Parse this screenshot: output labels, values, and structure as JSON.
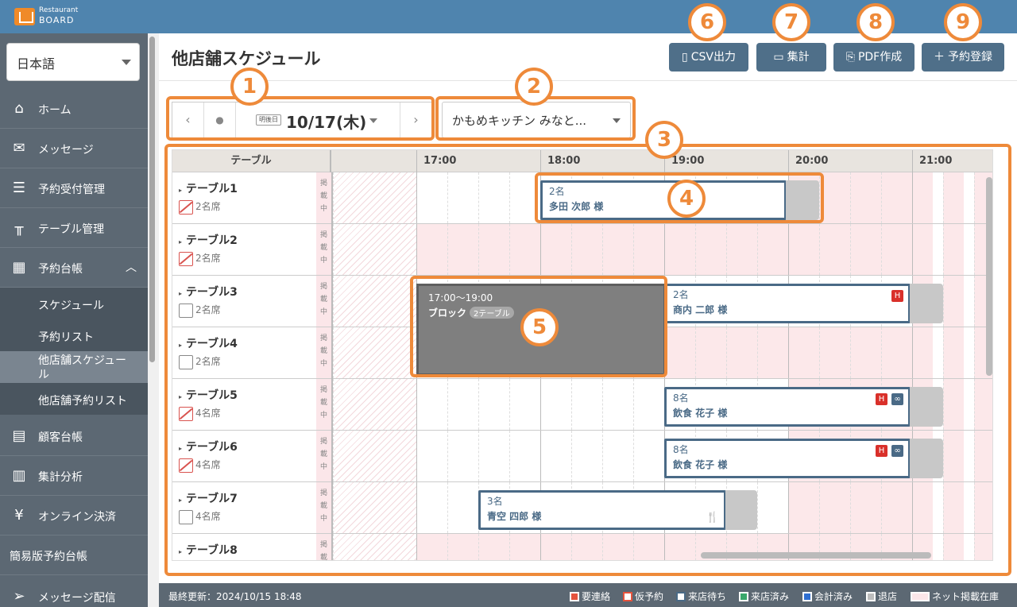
{
  "app": {
    "brand_top": "Restaurant",
    "brand_bottom": "BOARD"
  },
  "sidebar": {
    "language": "日本語",
    "items": [
      {
        "label": "ホーム"
      },
      {
        "label": "メッセージ"
      },
      {
        "label": "予約受付管理"
      },
      {
        "label": "テーブル管理"
      },
      {
        "label": "予約台帳"
      }
    ],
    "sub_items": [
      {
        "label": "スケジュール"
      },
      {
        "label": "予約リスト"
      },
      {
        "label": "他店舗スケジュール"
      },
      {
        "label": "他店舗予約リスト"
      }
    ],
    "items2": [
      {
        "label": "顧客台帳"
      },
      {
        "label": "集計分析"
      },
      {
        "label": "オンライン決済"
      }
    ],
    "simple_ledger": "簡易版予約台帳",
    "message_delivery": "メッセージ配信"
  },
  "header": {
    "title": "他店舗スケジュール",
    "buttons": {
      "csv": "CSV出力",
      "summary": "集計",
      "pdf": "PDF作成",
      "reserve": "予約登録"
    }
  },
  "datebar": {
    "chip": "明後日",
    "date": "10/17(木)",
    "dot": "●",
    "prev": "‹",
    "next": "›"
  },
  "store": {
    "selected": "かもめキッチン みなと..."
  },
  "grid": {
    "col_header": "テーブル",
    "hours": [
      "17:00",
      "18:00",
      "19:00",
      "20:00",
      "21:00"
    ],
    "keisai": "掲\n載\n中",
    "rows": [
      {
        "name": "テーブル1",
        "seats": "2名席"
      },
      {
        "name": "テーブル2",
        "seats": "2名席"
      },
      {
        "name": "テーブル3",
        "seats": "2名席"
      },
      {
        "name": "テーブル4",
        "seats": "2名席"
      },
      {
        "name": "テーブル5",
        "seats": "4名席"
      },
      {
        "name": "テーブル6",
        "seats": "4名席"
      },
      {
        "name": "テーブル7",
        "seats": "4名席"
      },
      {
        "name": "テーブル8",
        "seats": ""
      }
    ],
    "reservations": [
      {
        "count": "2名",
        "name": "多田 次郎 様"
      },
      {
        "count": "2名",
        "name": "商内 二郎 様",
        "tag": "H"
      },
      {
        "count": "8名",
        "name": "飲食 花子 様",
        "tag": "H"
      },
      {
        "count": "8名",
        "name": "飲食 花子 様",
        "tag": "H"
      },
      {
        "count": "3名",
        "name": "青空 四郎 様",
        "icon": "🍴"
      }
    ],
    "block": {
      "time": "17:00〜19:00",
      "label": "ブロック",
      "chip": "2テーブル"
    }
  },
  "annotations": [
    "1",
    "2",
    "3",
    "4",
    "5",
    "6",
    "7",
    "8",
    "9"
  ],
  "footer": {
    "updated": "最終更新：2024/10/15 18:48",
    "legend": [
      {
        "label": "要連絡",
        "color": "#e5533d"
      },
      {
        "label": "仮予約",
        "color": "#e5533d"
      },
      {
        "label": "来店待ち",
        "color": "#4a6a86"
      },
      {
        "label": "来店済み",
        "color": "#3aa86b"
      },
      {
        "label": "会計済み",
        "color": "#2f6fd1"
      },
      {
        "label": "退店",
        "color": "#bdbdbd"
      },
      {
        "label": "ネット掲載在庫",
        "color": "#fbe6e9"
      }
    ]
  }
}
